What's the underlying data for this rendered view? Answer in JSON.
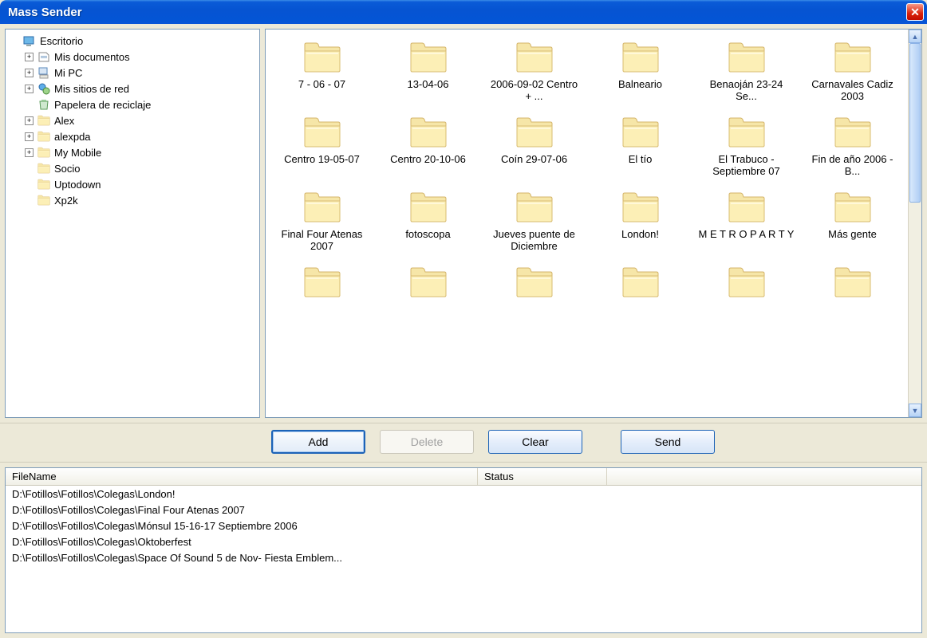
{
  "window": {
    "title": "Mass Sender"
  },
  "tree": [
    {
      "label": "Escritorio",
      "icon": "desktop",
      "expander": "none",
      "indent": 0
    },
    {
      "label": "Mis documentos",
      "icon": "docs",
      "expander": "+",
      "indent": 1
    },
    {
      "label": "Mi PC",
      "icon": "pc",
      "expander": "+",
      "indent": 1
    },
    {
      "label": "Mis sitios de red",
      "icon": "net",
      "expander": "+",
      "indent": 1
    },
    {
      "label": "Papelera de reciclaje",
      "icon": "trash",
      "expander": "none",
      "indent": 1
    },
    {
      "label": "Alex",
      "icon": "folder",
      "expander": "+",
      "indent": 1
    },
    {
      "label": "alexpda",
      "icon": "folder",
      "expander": "+",
      "indent": 1
    },
    {
      "label": "My Mobile",
      "icon": "folder",
      "expander": "+",
      "indent": 1
    },
    {
      "label": "Socio",
      "icon": "folder",
      "expander": "none",
      "indent": 1
    },
    {
      "label": "Uptodown",
      "icon": "folder",
      "expander": "none",
      "indent": 1
    },
    {
      "label": "Xp2k",
      "icon": "folder",
      "expander": "none",
      "indent": 1
    }
  ],
  "folders": [
    {
      "name": "7 - 06 - 07"
    },
    {
      "name": "13-04-06"
    },
    {
      "name": "2006-09-02 Centro + ..."
    },
    {
      "name": "Balneario"
    },
    {
      "name": "Benaoján 23-24 Se..."
    },
    {
      "name": "Carnavales Cadiz 2003"
    },
    {
      "name": "Centro 19-05-07"
    },
    {
      "name": "Centro 20-10-06"
    },
    {
      "name": "Coín 29-07-06"
    },
    {
      "name": "El tío"
    },
    {
      "name": "El Trabuco - Septiembre 07"
    },
    {
      "name": "Fin de año 2006 - B..."
    },
    {
      "name": "Final Four Atenas 2007"
    },
    {
      "name": "fotoscopa"
    },
    {
      "name": "Jueves puente de Diciembre"
    },
    {
      "name": "London!"
    },
    {
      "name": "M E T R O P A R T Y"
    },
    {
      "name": "Más gente"
    },
    {
      "name": ""
    },
    {
      "name": ""
    },
    {
      "name": ""
    },
    {
      "name": ""
    },
    {
      "name": ""
    },
    {
      "name": ""
    }
  ],
  "buttons": {
    "add": "Add",
    "delete": "Delete",
    "clear": "Clear",
    "send": "Send"
  },
  "list": {
    "columns": {
      "file": "FileName",
      "status": "Status"
    },
    "rows": [
      {
        "file": "D:\\Fotillos\\Fotillos\\Colegas\\London!",
        "status": ""
      },
      {
        "file": "D:\\Fotillos\\Fotillos\\Colegas\\Final Four Atenas 2007",
        "status": ""
      },
      {
        "file": "D:\\Fotillos\\Fotillos\\Colegas\\Mónsul 15-16-17 Septiembre 2006",
        "status": ""
      },
      {
        "file": "D:\\Fotillos\\Fotillos\\Colegas\\Oktoberfest",
        "status": ""
      },
      {
        "file": "D:\\Fotillos\\Fotillos\\Colegas\\Space Of Sound 5 de Nov- Fiesta Emblem...",
        "status": ""
      }
    ]
  }
}
